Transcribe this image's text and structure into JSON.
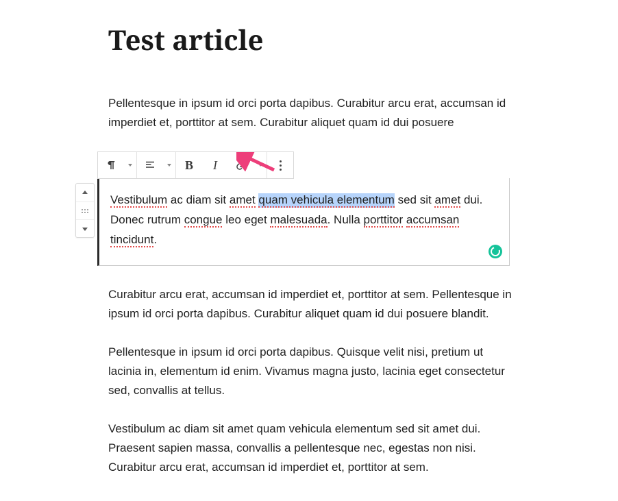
{
  "title": "Test article",
  "para1": "Pellentesque in ipsum id orci porta dapibus. Curabitur arcu erat, accumsan id imperdiet et, porttitor at sem. Curabitur aliquet quam id dui posuere",
  "editable": {
    "w_vestibulum": "Vestibulum",
    "t1": " ac diam sit ",
    "w_amet1": "amet",
    "t2": " ",
    "selected": "quam vehicula elementum",
    "t3": " sed sit ",
    "w_amet2": "amet",
    "t4": " dui. Donec rutrum ",
    "w_congue": "congue",
    "t5": " leo eget ",
    "w_malesuada": "malesuada",
    "t6": ". Nulla ",
    "w_porttitor": "porttitor",
    "t7": " ",
    "w_accumsan": "accumsan",
    "t8": " ",
    "w_tincidunt": "tincidunt",
    "t9": "."
  },
  "para3": "Curabitur arcu erat, accumsan id imperdiet et, porttitor at sem. Pellentesque in ipsum id orci porta dapibus. Curabitur aliquet quam id dui posuere blandit.",
  "para4": "Pellentesque in ipsum id orci porta dapibus. Quisque velit nisi, pretium ut lacinia in, elementum id enim. Vivamus magna justo, lacinia eget consectetur sed, convallis at tellus.",
  "para5": "Vestibulum ac diam sit amet quam vehicula elementum sed sit amet dui. Praesent sapien massa, convallis a pellentesque nec, egestas non nisi. Curabitur arcu erat, accumsan id imperdiet et, porttitor at sem.",
  "toolbar": {
    "bold_glyph": "B",
    "italic_glyph": "I"
  }
}
